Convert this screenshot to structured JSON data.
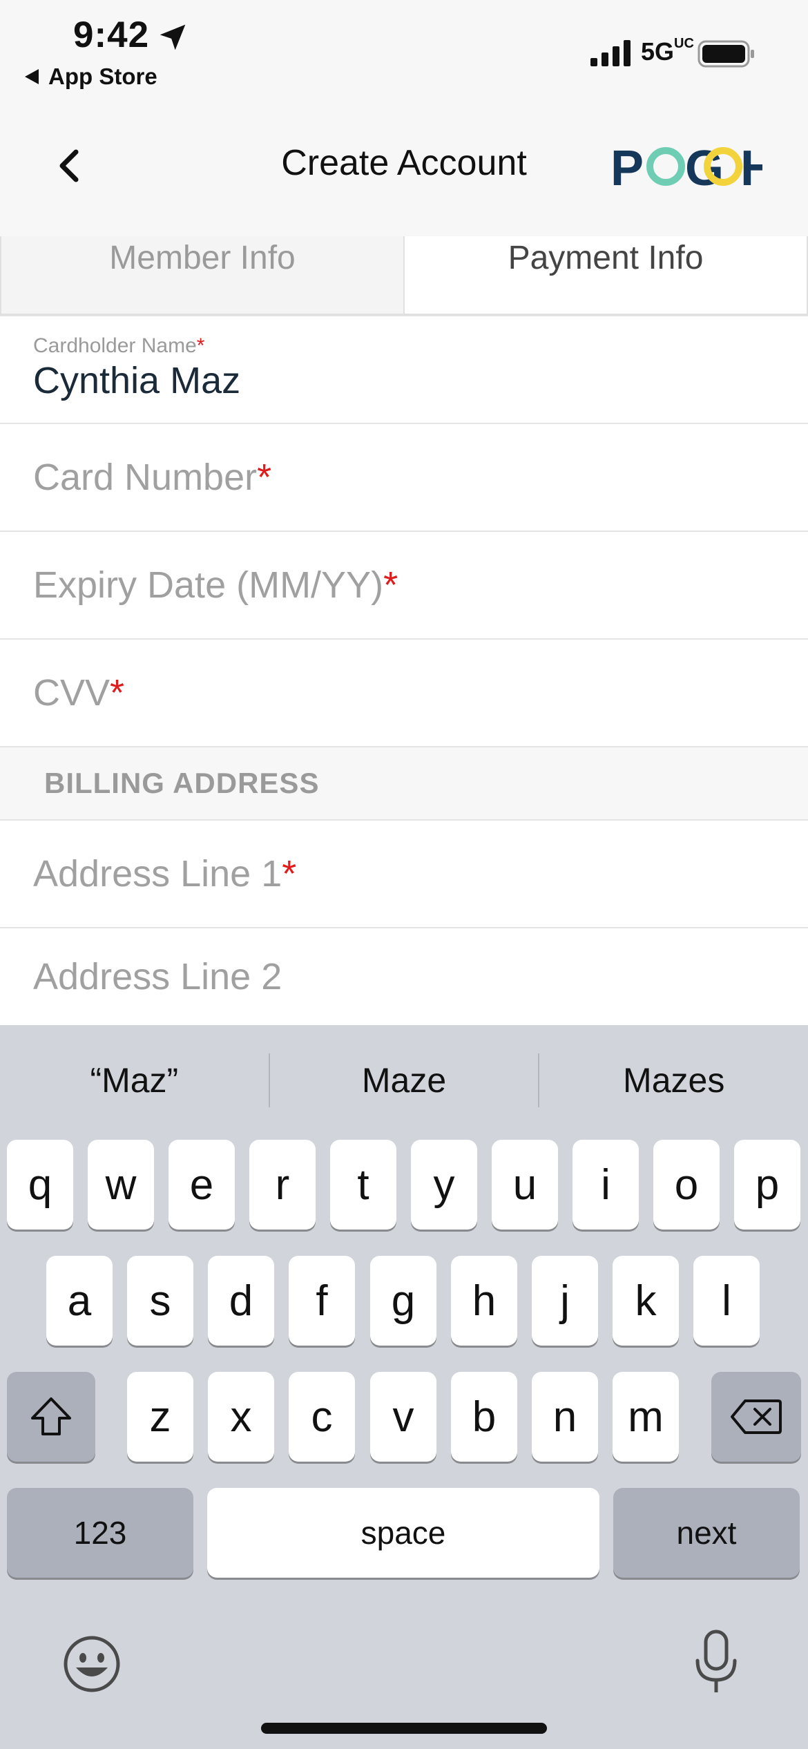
{
  "status_bar": {
    "time": "9:42",
    "back_app": "App Store",
    "network": "5G",
    "network_suffix": "UC"
  },
  "nav": {
    "title": "Create Account",
    "logo_text": "POGOH",
    "colors": {
      "logo_dark": "#15375a",
      "logo_teal": "#6fcdb4",
      "logo_yellow": "#f2d33c"
    }
  },
  "tabs": [
    {
      "label": "Member Info",
      "active": false
    },
    {
      "label": "Payment Info",
      "active": true
    }
  ],
  "form": {
    "cardholder": {
      "label": "Cardholder Name",
      "required": "*",
      "value": "Cynthia Maz"
    },
    "card_number": {
      "placeholder": "Card Number",
      "required": "*"
    },
    "expiry": {
      "placeholder": "Expiry Date (MM/YY)",
      "required": "*"
    },
    "cvv": {
      "placeholder": "CVV",
      "required": "*"
    },
    "billing_section": "BILLING ADDRESS",
    "address1": {
      "placeholder": "Address Line 1",
      "required": "*"
    },
    "address2": {
      "placeholder": "Address Line 2"
    }
  },
  "keyboard": {
    "suggestions": [
      "“Maz”",
      "Maze",
      "Mazes"
    ],
    "row1": [
      "q",
      "w",
      "e",
      "r",
      "t",
      "y",
      "u",
      "i",
      "o",
      "p"
    ],
    "row2": [
      "a",
      "s",
      "d",
      "f",
      "g",
      "h",
      "j",
      "k",
      "l"
    ],
    "row3": [
      "z",
      "x",
      "c",
      "v",
      "b",
      "n",
      "m"
    ],
    "numbers_label": "123",
    "space_label": "space",
    "return_label": "next"
  }
}
